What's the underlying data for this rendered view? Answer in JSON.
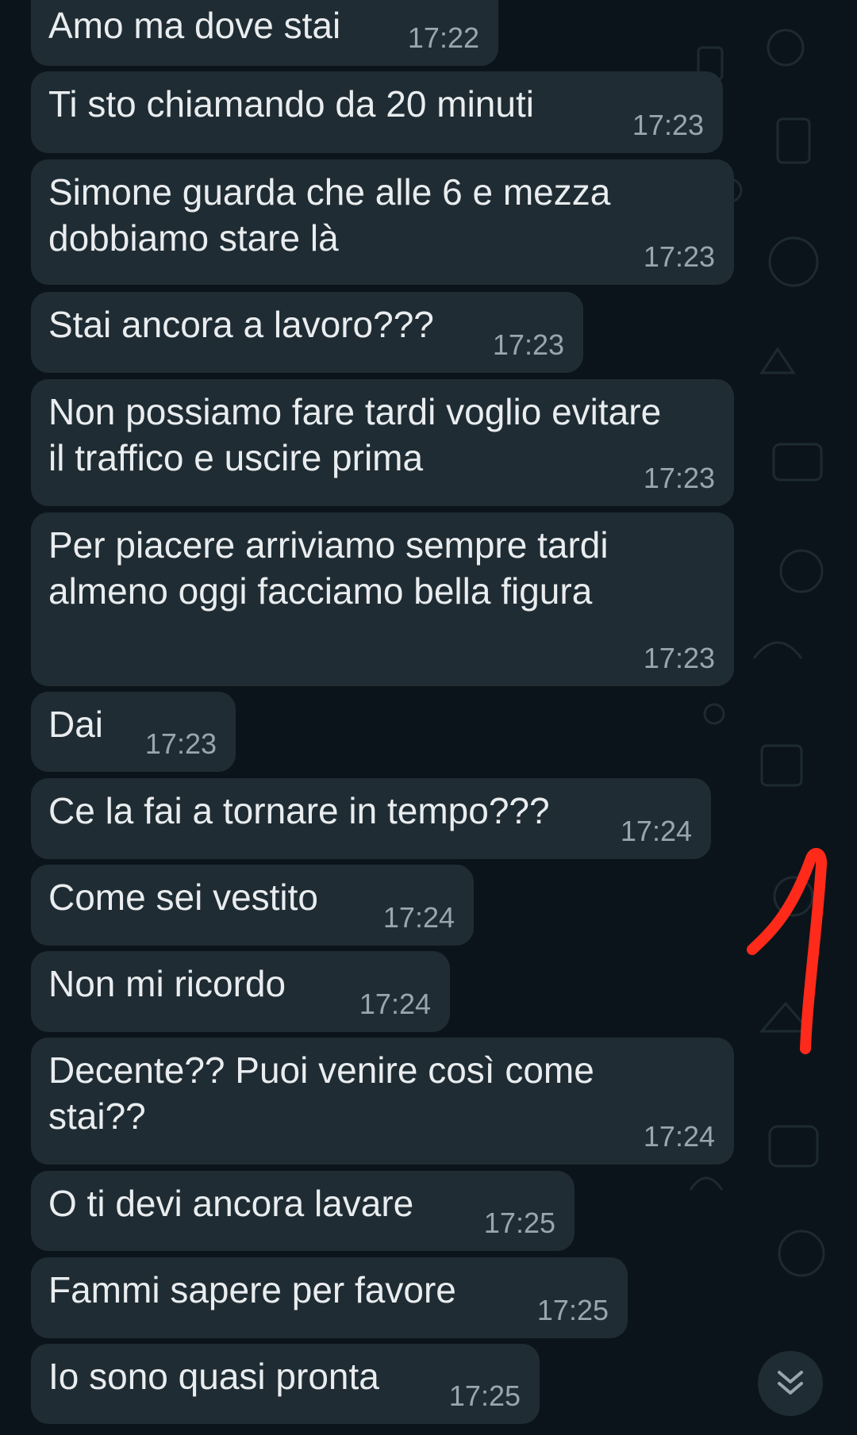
{
  "messages": [
    {
      "text": "Amo ma dove stai",
      "time": "17:22"
    },
    {
      "text": "Ti sto chiamando da 20 minuti",
      "time": "17:23"
    },
    {
      "text": "Simone guarda che alle 6 e mezza\ndobbiamo stare là",
      "time": "17:23"
    },
    {
      "text": "Stai ancora a lavoro???",
      "time": "17:23"
    },
    {
      "text": "Non possiamo fare tardi voglio evitare\nil traffico e uscire prima",
      "time": "17:23"
    },
    {
      "text": "Per piacere arriviamo sempre tardi\nalmeno oggi facciamo bella figura",
      "time": "17:23"
    },
    {
      "text": "Dai",
      "time": "17:23"
    },
    {
      "text": "Ce la fai a tornare in tempo???",
      "time": "17:24"
    },
    {
      "text": "Come sei vestito",
      "time": "17:24"
    },
    {
      "text": "Non mi ricordo",
      "time": "17:24"
    },
    {
      "text": "Decente?? Puoi venire così come\nstai??",
      "time": "17:24"
    },
    {
      "text": "O ti devi ancora lavare",
      "time": "17:25"
    },
    {
      "text": "Fammi sapere per favore",
      "time": "17:25"
    },
    {
      "text": "Io sono quasi pronta",
      "time": "17:25"
    }
  ],
  "scroll_button": {
    "icon": "double-chevron-down-icon"
  },
  "annotation": {
    "text": "1",
    "color": "#ff2a1a"
  },
  "colors": {
    "background": "#0b141a",
    "bubble": "#202c33",
    "text": "#e9edef",
    "time": "#9aa6ad"
  }
}
